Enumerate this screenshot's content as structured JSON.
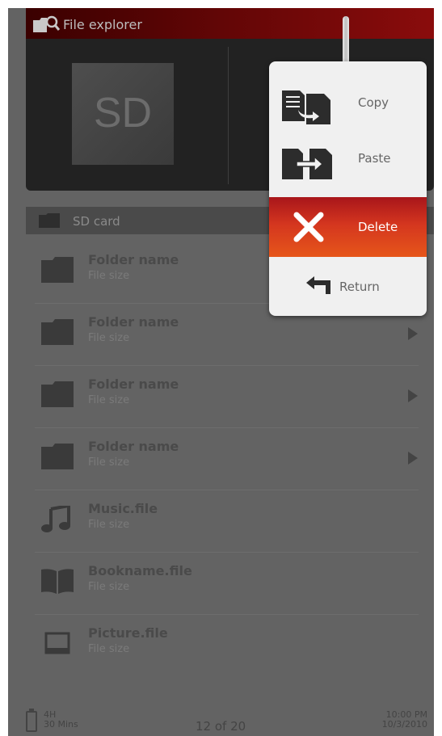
{
  "header": {
    "title": "File explorer"
  },
  "top_panel": {
    "sd_label": "SD"
  },
  "breadcrumb": {
    "label": "SD card"
  },
  "items": [
    {
      "name": "Folder name",
      "size": "File size",
      "icon": "folder-icon",
      "arrow": false
    },
    {
      "name": "Folder name",
      "size": "File size",
      "icon": "folder-icon",
      "arrow": true
    },
    {
      "name": "Folder name",
      "size": "File size",
      "icon": "folder-icon",
      "arrow": true
    },
    {
      "name": "Folder name",
      "size": "File size",
      "icon": "folder-icon",
      "arrow": true
    },
    {
      "name": "Music.file",
      "size": "File size",
      "icon": "music-note-icon",
      "arrow": false
    },
    {
      "name": "Bookname.file",
      "size": "File size",
      "icon": "book-icon",
      "arrow": false
    },
    {
      "name": "Picture.file",
      "size": "File size",
      "icon": "picture-icon",
      "arrow": false
    }
  ],
  "status": {
    "battery_hours": "4H",
    "battery_mins": "30 Mins",
    "page": "12  of  20",
    "time": "10:00 PM",
    "date": "10/3/2010"
  },
  "menu": {
    "copy": "Copy",
    "paste": "Paste",
    "delete": "Delete",
    "return": "Return"
  },
  "colors": {
    "accent_red": "#c0281c",
    "header_red": "#8a0c0c"
  }
}
